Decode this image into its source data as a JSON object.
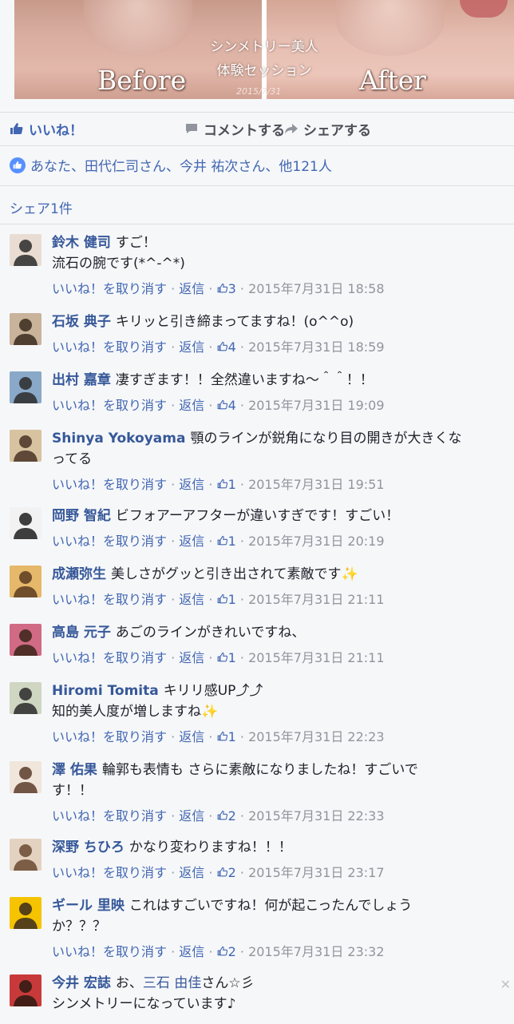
{
  "photo": {
    "label_before": "Before",
    "label_after": "After",
    "caption_line1": "シンメトリー美人",
    "caption_line2": "体験セッション",
    "date": "2015/7/31"
  },
  "actions": {
    "like": "いいね！",
    "comment": "コメントする",
    "share": "シェアする"
  },
  "likes_summary": "あなた、田代仁司さん、今井 祐次さん、他121人",
  "shares_summary": "シェア1件",
  "meta_labels": {
    "unlike": "いいね！を取り消す",
    "sep": "·",
    "reply": "返信"
  },
  "comments": [
    {
      "name": "鈴木 健司",
      "text": "すご！",
      "text2": "流石の腕です(*^-^*)",
      "likes": "3",
      "time": "2015年7月31日 18:58"
    },
    {
      "name": "石坂 典子",
      "text": "キリッと引き締まってますね！(o^^o)",
      "likes": "4",
      "time": "2015年7月31日 18:59"
    },
    {
      "name": "出村 嘉章",
      "text": "凄すぎます！！全然違いますね〜＾＾！！",
      "likes": "4",
      "time": "2015年7月31日 19:09"
    },
    {
      "name": "Shinya Yokoyama",
      "text": "顎のラインが鋭角になり目の開きが大きくな",
      "text2": "ってる",
      "likes": "1",
      "time": "2015年7月31日 19:51"
    },
    {
      "name": "岡野 智紀",
      "text": "ビフォアーアフターが違いすぎです！すごい！",
      "likes": "1",
      "time": "2015年7月31日 20:19"
    },
    {
      "name": "成瀬弥生",
      "text": "美しさがグッと引き出されて素敵です✨",
      "likes": "1",
      "time": "2015年7月31日 21:11"
    },
    {
      "name": "高島 元子",
      "text": "あごのラインがきれいですね、",
      "likes": "1",
      "time": "2015年7月31日 21:11"
    },
    {
      "name": "Hiromi Tomita",
      "text": "キリリ感UP⤴⤴",
      "text2": "知的美人度が増しますね✨",
      "likes": "1",
      "time": "2015年7月31日 22:23"
    },
    {
      "name": "澤 佑果",
      "text": "輪郭も表情も さらに素敵になりましたね！すごいで",
      "text2": "す！！",
      "likes": "2",
      "time": "2015年7月31日 22:33"
    },
    {
      "name": "深野 ちひろ",
      "text": "かなり変わりますね！！！",
      "likes": "2",
      "time": "2015年7月31日 23:17"
    },
    {
      "name": "ギール 里映",
      "text": "これはすごいですね！何が起こったんでしょう",
      "text2": "か？？？",
      "likes": "2",
      "time": "2015年7月31日 23:32"
    },
    {
      "name": "今井 宏誌",
      "text": "お、",
      "mention": "三石 由佳",
      "text_after": "さん☆彡",
      "text2": "シンメトリーになっています♪"
    }
  ],
  "colors": {
    "link": "#365899",
    "action_blue": "#4267b2",
    "meta_gray": "#90949c",
    "background": "#f6f7f9"
  }
}
